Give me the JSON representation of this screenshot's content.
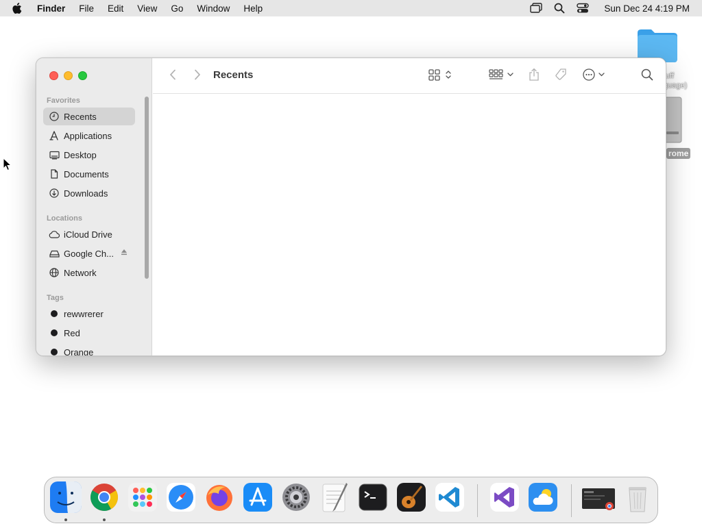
{
  "menubar": {
    "apple_icon": "apple-logo-icon",
    "app_name": "Finder",
    "items": [
      "File",
      "Edit",
      "View",
      "Go",
      "Window",
      "Help"
    ],
    "status_icons": [
      "screen-mirroring-icon",
      "spotlight-search-icon",
      "control-center-icon"
    ],
    "clock": "Sun Dec 24  4:19 PM"
  },
  "desktop": {
    "folder_label": "tuff\nguage)",
    "disk_label": "rome"
  },
  "window": {
    "title": "Recents",
    "traffic_lights": [
      "close",
      "minimize",
      "zoom"
    ],
    "toolbar_icons": [
      "back-chevron-icon",
      "forward-chevron-icon",
      "icon-view-icon",
      "group-icon",
      "share-icon",
      "tag-icon",
      "more-actions-icon",
      "search-icon"
    ],
    "sidebar": {
      "favorites_header": "Favorites",
      "favorites": [
        {
          "label": "Recents",
          "icon": "clock-icon",
          "selected": true
        },
        {
          "label": "Applications",
          "icon": "applications-icon"
        },
        {
          "label": "Desktop",
          "icon": "desktop-icon"
        },
        {
          "label": "Documents",
          "icon": "document-icon"
        },
        {
          "label": "Downloads",
          "icon": "download-icon"
        }
      ],
      "locations_header": "Locations",
      "locations": [
        {
          "label": "iCloud Drive",
          "icon": "cloud-icon"
        },
        {
          "label": "Google Ch...",
          "icon": "drive-icon",
          "eject": true
        },
        {
          "label": "Network",
          "icon": "globe-icon"
        }
      ],
      "tags_header": "Tags",
      "tags": [
        {
          "label": "rewwrerer",
          "color": "#1d1d1f"
        },
        {
          "label": "Red",
          "color": "#1d1d1f"
        },
        {
          "label": "Orange",
          "color": "#1d1d1f"
        }
      ]
    }
  },
  "dock": {
    "apps": [
      "Finder",
      "Google Chrome",
      "Launchpad",
      "Safari",
      "Firefox",
      "App Store",
      "System Settings",
      "TextEdit",
      "Terminal",
      "GarageBand",
      "Visual Studio Code",
      "Visual Studio",
      "Weather",
      "Google Chrome Window",
      "Trash"
    ]
  },
  "colors": {
    "close": "#fe5f57",
    "minimize": "#febc2e",
    "zoom": "#28c840",
    "selection": "#d4d4d4"
  }
}
